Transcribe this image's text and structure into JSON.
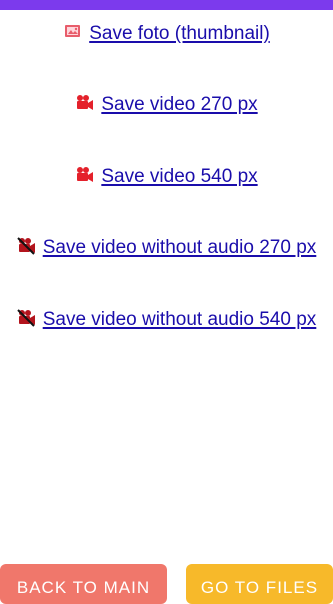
{
  "links": [
    {
      "label": "Save foto (thumbnail)",
      "icon": "photo-icon"
    },
    {
      "label": "Save video 270 px",
      "icon": "video-camera-icon"
    },
    {
      "label": "Save video 540 px",
      "icon": "video-camera-icon"
    },
    {
      "label": "Save video without audio 270 px",
      "icon": "muted-video-camera-icon"
    },
    {
      "label": "Save video without audio 540 px",
      "icon": "muted-video-camera-icon"
    }
  ],
  "buttons": {
    "back_label": "BACK TO MAIN",
    "files_label": "GO TO FILES"
  },
  "colors": {
    "top_strip": "#7c3aed",
    "link": "#1a0dab",
    "back_button": "#f0776b",
    "files_button": "#f7b92a"
  }
}
